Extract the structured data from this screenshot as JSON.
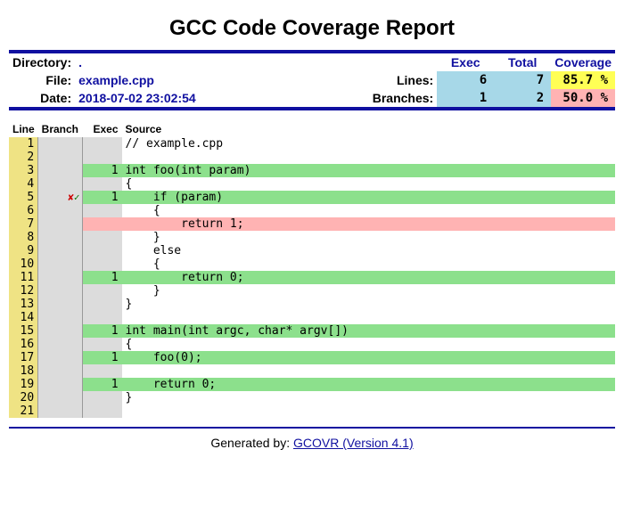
{
  "title": "GCC Code Coverage Report",
  "header": {
    "directory_label": "Directory:",
    "directory": ".",
    "file_label": "File:",
    "file": "example.cpp",
    "date_label": "Date:",
    "date": "2018-07-02 23:02:54",
    "exec_label": "Exec",
    "total_label": "Total",
    "coverage_label": "Coverage",
    "lines_label": "Lines:",
    "branches_label": "Branches:",
    "lines_exec": "6",
    "lines_total": "7",
    "lines_cov": "85.7 %",
    "branches_exec": "1",
    "branches_total": "2",
    "branches_cov": "50.0 %"
  },
  "columns": {
    "line": "Line",
    "branch": "Branch",
    "exec": "Exec",
    "source": "Source"
  },
  "branch_marks": {
    "miss": "✘",
    "hit": "✓"
  },
  "rows": [
    {
      "n": "1",
      "b": "",
      "e": "",
      "s": "// example.cpp",
      "st": ""
    },
    {
      "n": "2",
      "b": "",
      "e": "",
      "s": "",
      "st": ""
    },
    {
      "n": "3",
      "b": "",
      "e": "1",
      "s": "int foo(int param)",
      "st": "cov"
    },
    {
      "n": "4",
      "b": "",
      "e": "",
      "s": "{",
      "st": ""
    },
    {
      "n": "5",
      "b": "mh",
      "e": "1",
      "s": "    if (param)",
      "st": "cov"
    },
    {
      "n": "6",
      "b": "",
      "e": "",
      "s": "    {",
      "st": ""
    },
    {
      "n": "7",
      "b": "",
      "e": "",
      "s": "        return 1;",
      "st": "uncov"
    },
    {
      "n": "8",
      "b": "",
      "e": "",
      "s": "    }",
      "st": ""
    },
    {
      "n": "9",
      "b": "",
      "e": "",
      "s": "    else",
      "st": ""
    },
    {
      "n": "10",
      "b": "",
      "e": "",
      "s": "    {",
      "st": ""
    },
    {
      "n": "11",
      "b": "",
      "e": "1",
      "s": "        return 0;",
      "st": "cov"
    },
    {
      "n": "12",
      "b": "",
      "e": "",
      "s": "    }",
      "st": ""
    },
    {
      "n": "13",
      "b": "",
      "e": "",
      "s": "}",
      "st": ""
    },
    {
      "n": "14",
      "b": "",
      "e": "",
      "s": "",
      "st": ""
    },
    {
      "n": "15",
      "b": "",
      "e": "1",
      "s": "int main(int argc, char* argv[])",
      "st": "cov"
    },
    {
      "n": "16",
      "b": "",
      "e": "",
      "s": "{",
      "st": ""
    },
    {
      "n": "17",
      "b": "",
      "e": "1",
      "s": "    foo(0);",
      "st": "cov"
    },
    {
      "n": "18",
      "b": "",
      "e": "",
      "s": "",
      "st": ""
    },
    {
      "n": "19",
      "b": "",
      "e": "1",
      "s": "    return 0;",
      "st": "cov"
    },
    {
      "n": "20",
      "b": "",
      "e": "",
      "s": "}",
      "st": ""
    },
    {
      "n": "21",
      "b": "",
      "e": "",
      "s": "",
      "st": ""
    }
  ],
  "footer": {
    "prefix": "Generated by: ",
    "link": "GCOVR (Version 4.1)"
  }
}
